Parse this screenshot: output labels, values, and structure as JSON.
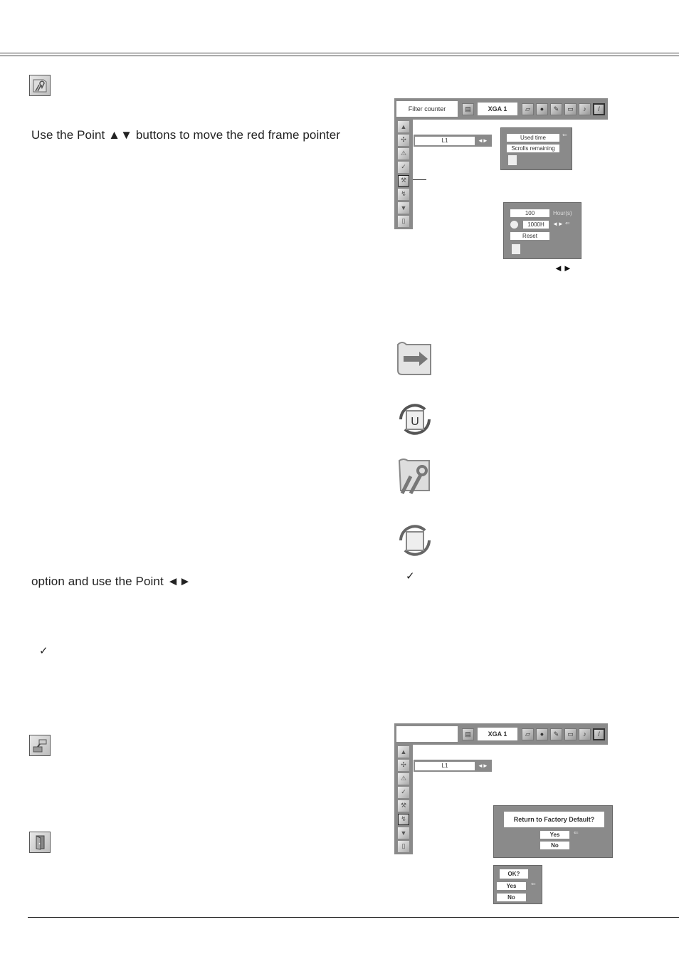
{
  "page": {
    "section_icon_top": "wrench-folder-icon",
    "paragraphs": {
      "intro": "Use the Point ▲▼ buttons to move the red frame pointer",
      "option": "option and use the Point ◄►"
    },
    "check_mark": "✓",
    "section_icon_factory": "factory-default-icon",
    "section_icon_exit": "exit-door-icon",
    "right_arrows": "◄►"
  },
  "menu1": {
    "title": "Filter counter",
    "source": "XGA 1",
    "l1_value": "L1",
    "l1_arrows": "◄►",
    "submenu": {
      "items": [
        "Used time",
        "Scrolls remaining"
      ]
    },
    "counter": {
      "hours_value": "100",
      "hours_unit": "Hour(s)",
      "timer_value": "1000H",
      "timer_arrows": "◄►",
      "reset_label": "Reset"
    }
  },
  "menu2": {
    "title": "",
    "source": "XGA 1",
    "l1_value": "L1",
    "l1_arrows": "◄►",
    "factory_dialog": {
      "question": "Return to Factory Default?",
      "yes": "Yes",
      "no": "No"
    },
    "confirm_dialog": {
      "question": "OK?",
      "yes": "Yes",
      "no": "No"
    }
  },
  "pointer_arrow": "⇐",
  "side_icons": [
    "up-arrow-icon",
    "fan-icon",
    "warning-icon",
    "check-setting-icon",
    "filter-icon",
    "factory-default-icon",
    "down-arrow-icon",
    "exit-icon"
  ],
  "top_icons": [
    "input-icon",
    "pc-adjust-icon",
    "image-select-icon",
    "color-icon",
    "screen-icon",
    "sound-icon",
    "setting-icon"
  ],
  "feature_icons": [
    "scroll-forward-icon",
    "scroll-reset-u-icon",
    "scroll-wrench-icon",
    "scroll-refresh-icon"
  ]
}
